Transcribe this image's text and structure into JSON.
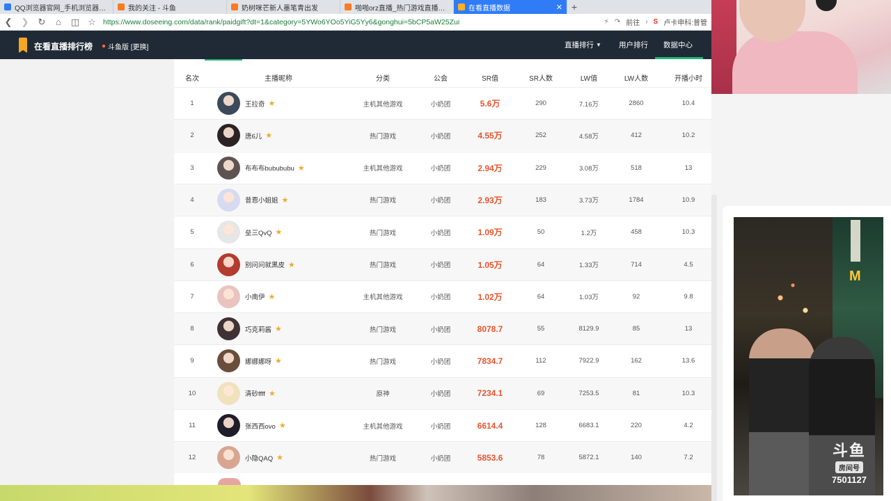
{
  "browser": {
    "tabs": [
      {
        "title": "QQ浏览器官网_手机浏览器_电脑浏览",
        "active": false,
        "color": "#2f7cf6"
      },
      {
        "title": "我的关注 - 斗鱼",
        "active": false,
        "color": "#ff7a22"
      },
      {
        "title": "奶树咪芒新人墨笔青出发",
        "active": false,
        "color": "#ff7a22"
      },
      {
        "title": "啪啪orz直播_热门游戏直播_斗鱼直播",
        "active": false,
        "color": "#ff7a22"
      },
      {
        "title": "在看直播数据",
        "active": true,
        "color": "#ffb020"
      }
    ],
    "new_tab": "+",
    "url": "https://www.doseeing.com/data/rank/paidgift?dt=1&category=5YWo6YOo5YiG5Yy6&gonghui=5bCP5aW25Zui",
    "go_label": "前往",
    "search_engine_label": "S",
    "search_text": "卢卡申科:普管"
  },
  "site": {
    "title": "在看直播排行榜",
    "platform": "斗鱼版 [更换]",
    "nav": {
      "rank": "直播排行",
      "users": "用户排行",
      "data_center": "数据中心"
    }
  },
  "table": {
    "headers": {
      "rank": "名次",
      "name": "主播昵称",
      "category": "分类",
      "guild": "公会",
      "sr": "SR值",
      "sr_count": "SR人数",
      "lw": "LW值",
      "lw_count": "LW人数",
      "hours": "开播小时"
    },
    "rows": [
      {
        "rank": "1",
        "name": "王拉奇",
        "category": "主机其他游戏",
        "guild": "小奶团",
        "sr": "5.6万",
        "sr_count": "290",
        "lw": "7.16万",
        "lw_count": "2860",
        "hours": "10.4",
        "avatar": "#3b4a5a"
      },
      {
        "rank": "2",
        "name": "唐6儿",
        "category": "热门游戏",
        "guild": "小奶团",
        "sr": "4.55万",
        "sr_count": "252",
        "lw": "4.58万",
        "lw_count": "412",
        "hours": "10.2",
        "avatar": "#2b2224"
      },
      {
        "rank": "3",
        "name": "布布布bubububu",
        "category": "主机其他游戏",
        "guild": "小奶团",
        "sr": "2.94万",
        "sr_count": "229",
        "lw": "3.08万",
        "lw_count": "518",
        "hours": "13",
        "avatar": "#5d5452"
      },
      {
        "rank": "4",
        "name": "昔恩小姐姐",
        "category": "热门游戏",
        "guild": "小奶团",
        "sr": "2.93万",
        "sr_count": "183",
        "lw": "3.73万",
        "lw_count": "1784",
        "hours": "10.9",
        "avatar": "#d7dbf0"
      },
      {
        "rank": "5",
        "name": "垒三QvQ",
        "category": "热门游戏",
        "guild": "小奶团",
        "sr": "1.09万",
        "sr_count": "50",
        "lw": "1.2万",
        "lw_count": "458",
        "hours": "10.3",
        "avatar": "#e6e6e6"
      },
      {
        "rank": "6",
        "name": "别问问就黑皮",
        "category": "热门游戏",
        "guild": "小奶团",
        "sr": "1.05万",
        "sr_count": "64",
        "lw": "1.33万",
        "lw_count": "714",
        "hours": "4.5",
        "avatar": "#b43b2f"
      },
      {
        "rank": "7",
        "name": "小南伊",
        "category": "主机其他游戏",
        "guild": "小奶团",
        "sr": "1.02万",
        "sr_count": "64",
        "lw": "1.03万",
        "lw_count": "92",
        "hours": "9.8",
        "avatar": "#e9c4be"
      },
      {
        "rank": "8",
        "name": "巧克莉酱",
        "category": "热门游戏",
        "guild": "小奶团",
        "sr": "8078.7",
        "sr_count": "55",
        "lw": "8129.9",
        "lw_count": "85",
        "hours": "13",
        "avatar": "#3e3234"
      },
      {
        "rank": "9",
        "name": "娜娜娜呀",
        "category": "热门游戏",
        "guild": "小奶团",
        "sr": "7834.7",
        "sr_count": "112",
        "lw": "7922.9",
        "lw_count": "162",
        "hours": "13.6",
        "avatar": "#6b4d3c"
      },
      {
        "rank": "10",
        "name": "清砂ffff",
        "category": "原神",
        "guild": "小奶团",
        "sr": "7234.1",
        "sr_count": "69",
        "lw": "7253.5",
        "lw_count": "81",
        "hours": "10.3",
        "avatar": "#efe2bd"
      },
      {
        "rank": "11",
        "name": "张西西ovo",
        "category": "主机其他游戏",
        "guild": "小奶团",
        "sr": "6614.4",
        "sr_count": "128",
        "lw": "6683.1",
        "lw_count": "220",
        "hours": "4.2",
        "avatar": "#1f1e28"
      },
      {
        "rank": "12",
        "name": "小隐QAQ",
        "category": "热门游戏",
        "guild": "小奶团",
        "sr": "5853.6",
        "sr_count": "78",
        "lw": "5872.1",
        "lw_count": "140",
        "hours": "7.2",
        "avatar": "#d8a690"
      }
    ]
  },
  "overlay": {
    "watermark_brand": "斗鱼",
    "watermark_room_label": "房间号",
    "watermark_room_id": "7501127"
  }
}
